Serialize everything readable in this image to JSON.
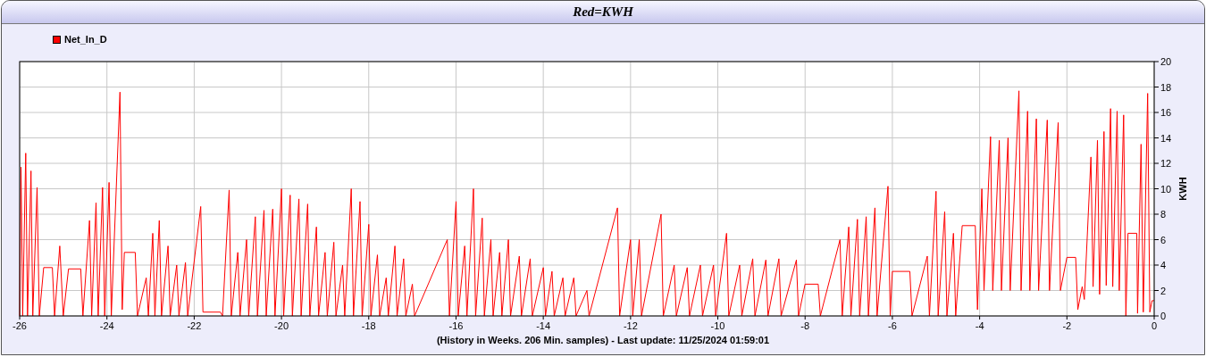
{
  "window": {
    "title": "Red=KWH"
  },
  "chart": {
    "chart_data": {
      "type": "line",
      "grid": true,
      "xlabel": "(History in Weeks. 206 Min. samples) - Last update: 11/25/2024 01:59:01",
      "ylabel": "KWH",
      "xlim": [
        -26,
        0
      ],
      "ylim": [
        0,
        20
      ],
      "xticks": [
        -26,
        -24,
        -22,
        -20,
        -18,
        -16,
        -14,
        -12,
        -10,
        -8,
        -6,
        -4,
        -2,
        0
      ],
      "yticks": [
        0,
        2,
        4,
        6,
        8,
        10,
        12,
        14,
        16,
        18,
        20
      ],
      "x": [
        -26,
        -25.97,
        -25.93,
        -25.86,
        -25.82,
        -25.74,
        -25.7,
        -25.6,
        -25.55,
        -25.45,
        -25.25,
        -25.2,
        -25.08,
        -25,
        -24.88,
        -24.6,
        -24.55,
        -24.4,
        -24.35,
        -24.25,
        -24.2,
        -24.1,
        -24.05,
        -23.95,
        -23.9,
        -23.7,
        -23.65,
        -23.6,
        -23.35,
        -23.3,
        -23.1,
        -23.05,
        -22.95,
        -22.9,
        -22.8,
        -22.75,
        -22.6,
        -22.55,
        -22.4,
        -22.35,
        -22.2,
        -22.15,
        -21.85,
        -21.8,
        -21.4,
        -21.35,
        -21.2,
        -21.15,
        -21,
        -20.95,
        -20.8,
        -20.75,
        -20.6,
        -20.55,
        -20.4,
        -20.35,
        -20.2,
        -20.15,
        -20,
        -19.95,
        -19.8,
        -19.75,
        -19.6,
        -19.55,
        -19.4,
        -19.35,
        -19.2,
        -19.15,
        -19,
        -18.95,
        -18.8,
        -18.75,
        -18.6,
        -18.55,
        -18.4,
        -18.35,
        -18.2,
        -18.15,
        -18,
        -17.95,
        -17.8,
        -17.75,
        -17.6,
        -17.55,
        -17.4,
        -17.35,
        -17.2,
        -17.15,
        -17,
        -16.95,
        -16.2,
        -16.15,
        -16,
        -15.95,
        -15.8,
        -15.75,
        -15.6,
        -15.55,
        -15.4,
        -15.35,
        -15.2,
        -15.15,
        -15,
        -14.95,
        -14.8,
        -14.75,
        -14.55,
        -14.5,
        -14.3,
        -14.25,
        -14,
        -13.95,
        -13.8,
        -13.75,
        -13.55,
        -13.5,
        -13.3,
        -13.25,
        -13,
        -12.95,
        -12.3,
        -12.25,
        -12,
        -11.95,
        -11.8,
        -11.75,
        -11.3,
        -11.25,
        -11,
        -10.95,
        -10.7,
        -10.65,
        -10.4,
        -10.35,
        -10.1,
        -10.05,
        -9.8,
        -9.75,
        -9.5,
        -9.45,
        -9.2,
        -9.15,
        -8.9,
        -8.85,
        -8.6,
        -8.55,
        -8.2,
        -8.15,
        -8,
        -7.7,
        -7.65,
        -7.2,
        -7.15,
        -7,
        -6.95,
        -6.8,
        -6.75,
        -6.6,
        -6.55,
        -6.4,
        -6.35,
        -6.1,
        -6.05,
        -6,
        -5.6,
        -5.55,
        -5.2,
        -5.15,
        -5,
        -4.95,
        -4.8,
        -4.75,
        -4.6,
        -4.55,
        -4.4,
        -4.1,
        -4.05,
        -3.95,
        -3.9,
        -3.75,
        -3.7,
        -3.55,
        -3.5,
        -3.35,
        -3.3,
        -3.1,
        -3.05,
        -2.9,
        -2.85,
        -2.7,
        -2.65,
        -2.45,
        -2.4,
        -2.2,
        -2.15,
        -2,
        -1.8,
        -1.75,
        -1.65,
        -1.6,
        -1.45,
        -1.4,
        -1.3,
        -1.25,
        -1.15,
        -1.1,
        -1,
        -0.95,
        -0.85,
        -0.8,
        -0.7,
        -0.65,
        -0.6,
        -0.4,
        -0.38,
        -0.3,
        -0.25,
        -0.15,
        -0.1,
        -0.05,
        0
      ],
      "series": [
        {
          "name": "Net_In_D",
          "color": "#ff0000",
          "values": [
            0,
            11.7,
            0,
            12.8,
            0,
            11.4,
            0,
            10.1,
            0,
            3.8,
            3.8,
            0,
            5.5,
            0,
            3.7,
            3.7,
            0,
            7.5,
            0,
            8.9,
            0,
            10.1,
            0,
            10.5,
            0,
            17.6,
            0.5,
            5,
            5,
            0,
            3,
            0,
            6.5,
            0,
            7.5,
            0,
            5.5,
            0,
            4,
            0,
            4.2,
            0,
            8.6,
            0.3,
            0.3,
            0,
            9.9,
            0,
            5,
            0,
            6,
            0,
            7.8,
            0,
            8.3,
            0,
            8.4,
            0,
            10,
            0,
            9.5,
            0,
            9.2,
            0,
            8.8,
            0,
            7,
            0,
            5,
            0,
            5.8,
            0,
            4,
            0,
            10,
            0,
            9,
            0,
            7.2,
            0,
            4.8,
            0,
            3,
            0,
            5.5,
            0,
            4.5,
            0,
            2.5,
            0,
            6,
            0,
            9,
            0,
            5.5,
            0,
            10,
            0,
            7.7,
            0,
            6,
            0,
            5,
            0,
            6,
            0,
            4.7,
            0,
            4.5,
            0,
            3.8,
            0,
            3.5,
            0,
            3,
            0,
            3,
            0,
            2,
            0,
            8.5,
            0,
            6,
            0,
            6,
            0,
            8,
            0,
            4,
            0,
            3.8,
            0,
            4,
            0,
            4,
            0,
            6.5,
            0,
            4,
            0,
            4.5,
            0,
            4.4,
            0,
            4.5,
            0,
            4.4,
            0,
            2.5,
            2.5,
            0,
            6,
            0,
            7,
            0,
            7.6,
            0,
            7.8,
            0,
            8.5,
            0,
            10.2,
            0,
            3.5,
            3.5,
            0,
            4.7,
            0,
            9.8,
            0,
            8.2,
            0,
            6.5,
            0,
            7.1,
            7.1,
            0.5,
            10,
            2,
            14.1,
            2,
            13.8,
            2,
            14,
            2,
            17.7,
            2,
            16.1,
            2,
            15.5,
            2,
            15.4,
            2,
            15.2,
            2,
            4.6,
            4.6,
            0.5,
            2.3,
            1.3,
            12.5,
            2.3,
            13.8,
            1.7,
            14.5,
            2.4,
            16.3,
            2.3,
            16.1,
            2,
            15.8,
            0,
            6.5,
            6.5,
            0.2,
            13.5,
            0.3,
            17.5,
            0.3,
            1.2,
            1.2
          ]
        }
      ]
    }
  }
}
